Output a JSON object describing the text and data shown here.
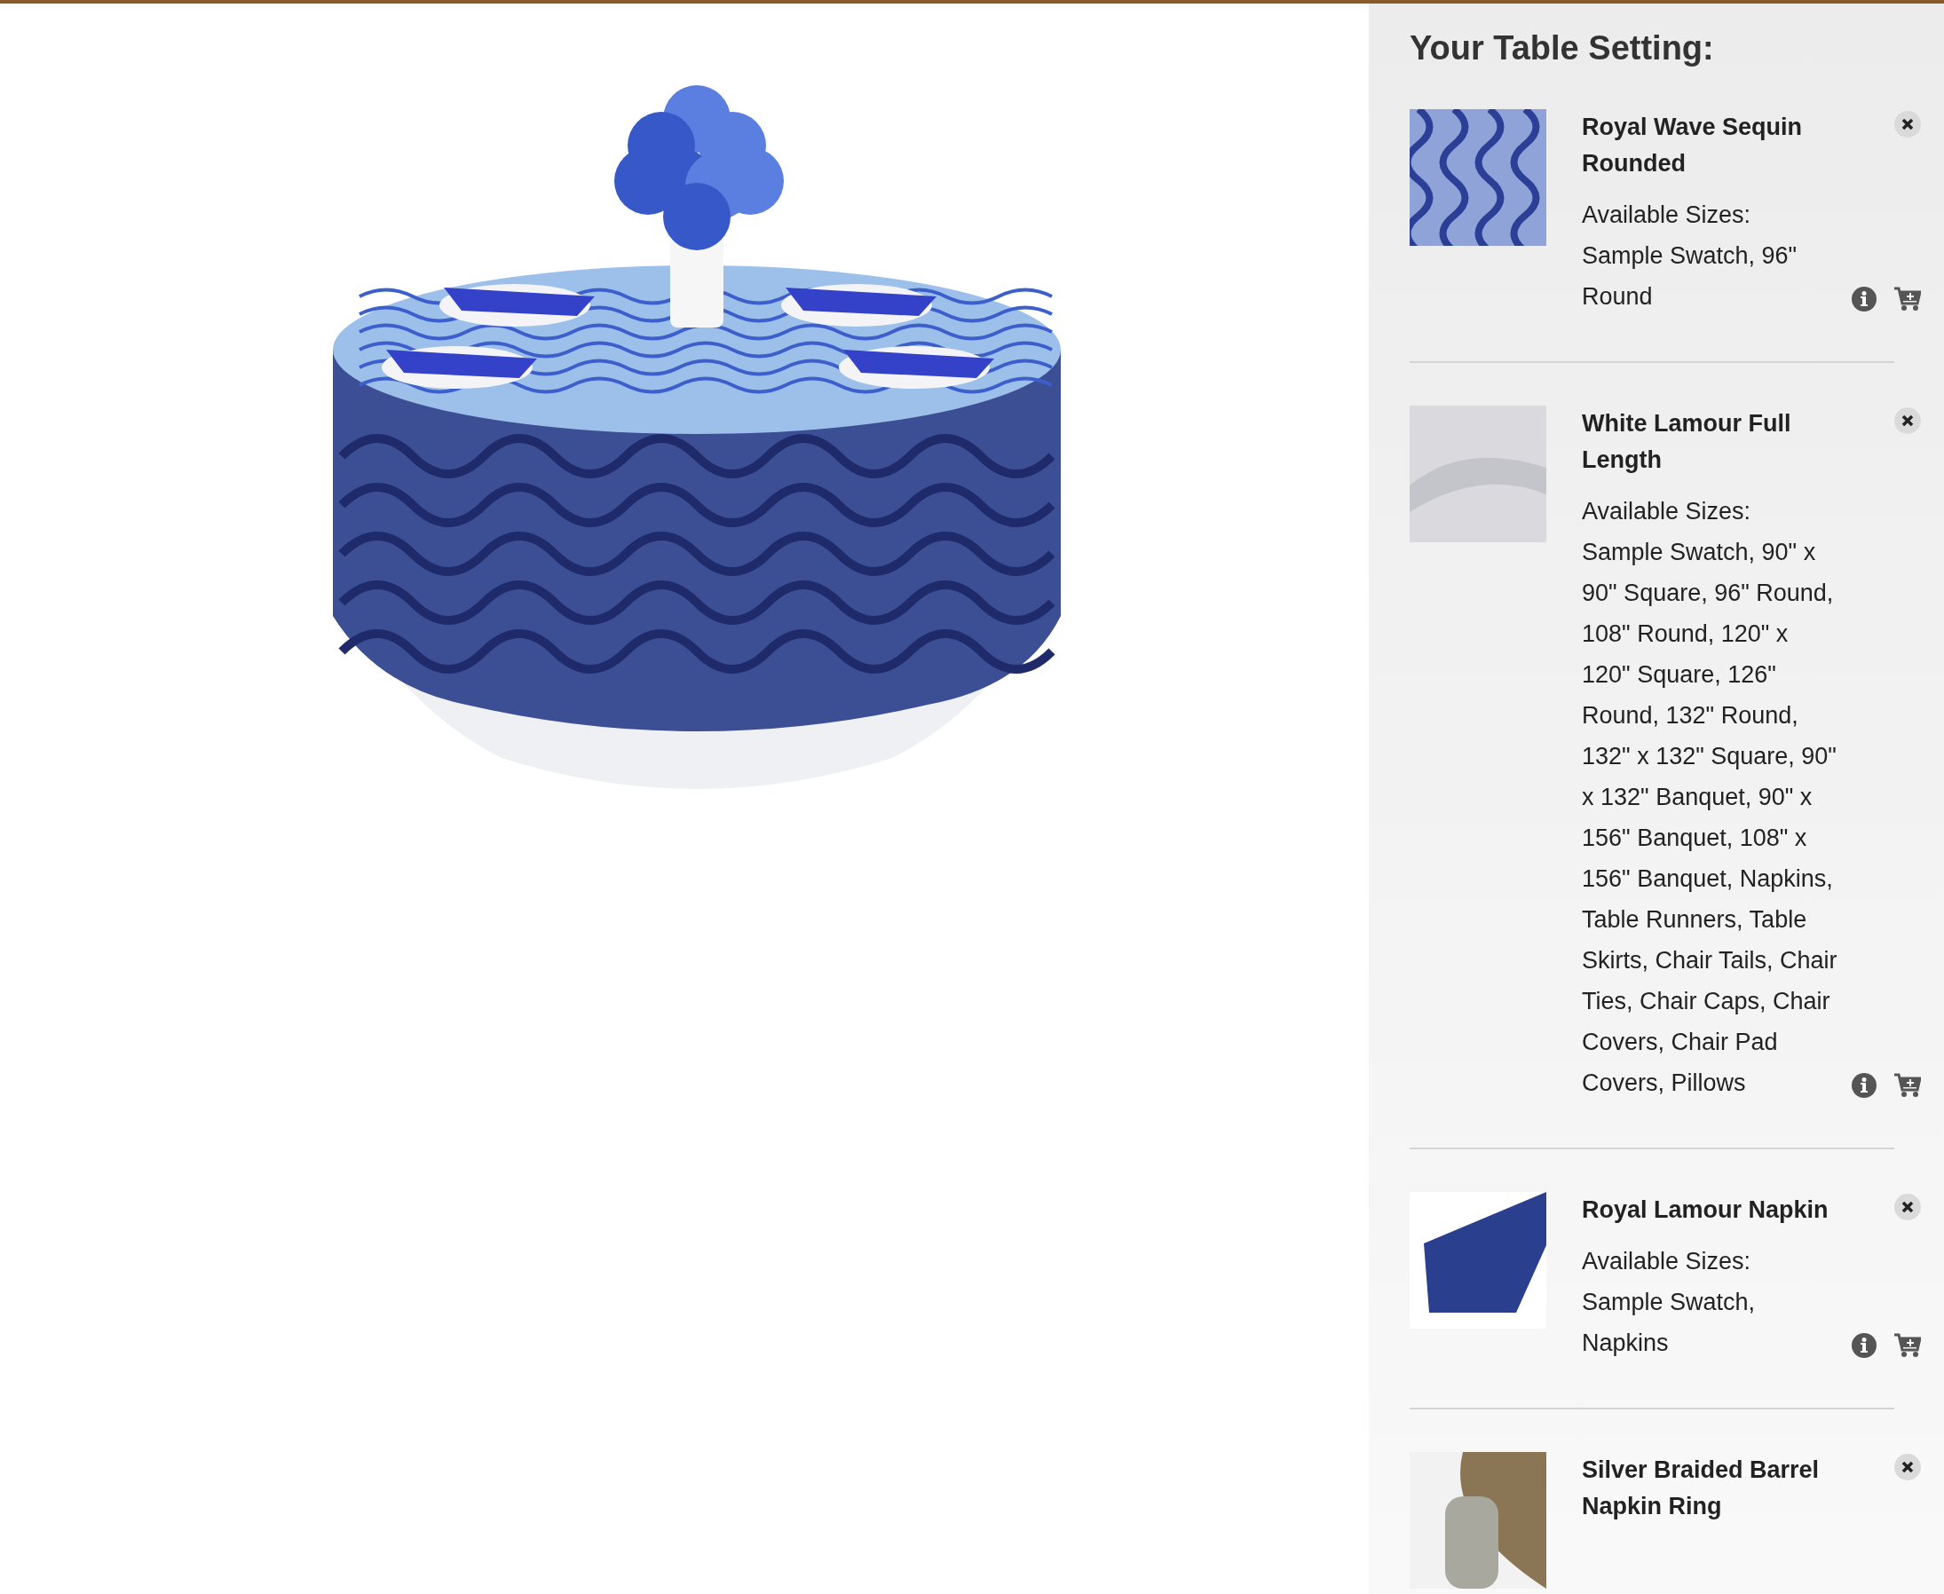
{
  "sidebar": {
    "title": "Your Table Setting:",
    "items": [
      {
        "kind": "wave",
        "name": "Royal Wave Sequin Rounded",
        "sizes_label": "Available Sizes:",
        "sizes": "Sample Swatch, 96\" Round"
      },
      {
        "kind": "satin",
        "name": "White Lamour Full Length",
        "sizes_label": "Available Sizes:",
        "sizes": "Sample Swatch, 90\" x 90\" Square, 96\" Round, 108\" Round, 120\" x 120\" Square, 126\" Round, 132\" Round, 132\" x 132\" Square, 90\" x 132\" Banquet, 90\" x 156\" Banquet, 108\" x 156\" Banquet, Napkins, Table Runners, Table Skirts, Chair Tails, Chair Ties, Chair Caps, Chair Covers, Chair Pad Covers, Pillows"
      },
      {
        "kind": "napkin",
        "name": "Royal Lamour Napkin",
        "sizes_label": "Available Sizes:",
        "sizes": "Sample Swatch, Napkins"
      },
      {
        "kind": "ring",
        "name": "Silver Braided Barrel Napkin Ring"
      }
    ]
  }
}
